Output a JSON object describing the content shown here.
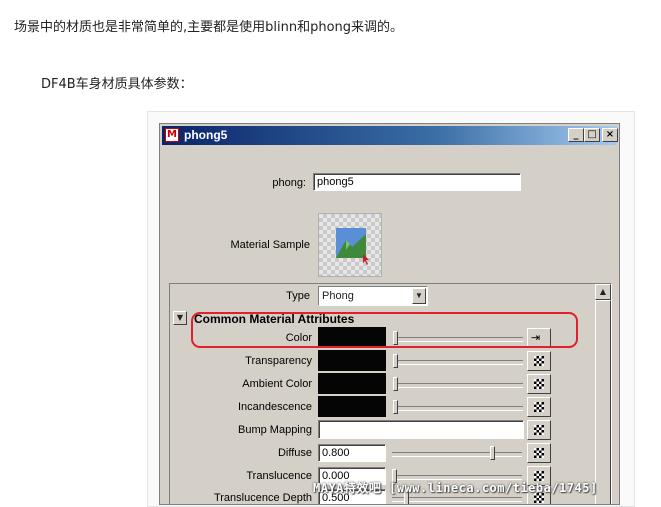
{
  "article": {
    "intro": "场景中的材质也是非常简单的,主要都是使用blinn和phong来调的。",
    "subheading": "DF4B车身材质具体参数："
  },
  "window": {
    "title": "phong5",
    "icon": "maya-icon",
    "controls": {
      "minimize": "_",
      "maximize": "□",
      "close": "×"
    }
  },
  "node": {
    "type_label": "phong:",
    "name_value": "phong5",
    "sample_label": "Material Sample"
  },
  "type_select": {
    "label": "Type",
    "value": "Phong"
  },
  "section": {
    "toggle": "▼",
    "title": "Common Material Attributes"
  },
  "attributes": [
    {
      "label": "Color",
      "kind": "swatch",
      "slider": 0.0,
      "map": "linked"
    },
    {
      "label": "Transparency",
      "kind": "swatch",
      "slider": 0.0,
      "map": "checker"
    },
    {
      "label": "Ambient Color",
      "kind": "swatch",
      "slider": 0.0,
      "map": "checker"
    },
    {
      "label": "Incandescence",
      "kind": "swatch",
      "slider": 0.0,
      "map": "checker"
    },
    {
      "label": "Bump Mapping",
      "kind": "field",
      "map": "checker"
    },
    {
      "label": "Diffuse",
      "kind": "number",
      "value": "0.800",
      "slider": 0.8,
      "map": "checker"
    },
    {
      "label": "Translucence",
      "kind": "number",
      "value": "0.000",
      "slider": 0.0,
      "map": "checker"
    },
    {
      "label": "Translucence Depth",
      "kind": "number",
      "value": "0.500",
      "slider": 0.1,
      "map": "checker"
    }
  ],
  "colors": {
    "highlight": "#e0202a",
    "title_bar": "#0a246a",
    "window_bg": "#d4d0c8"
  },
  "watermark": "MAYA特效吧  [www.lineca.com/tieba/1745]"
}
